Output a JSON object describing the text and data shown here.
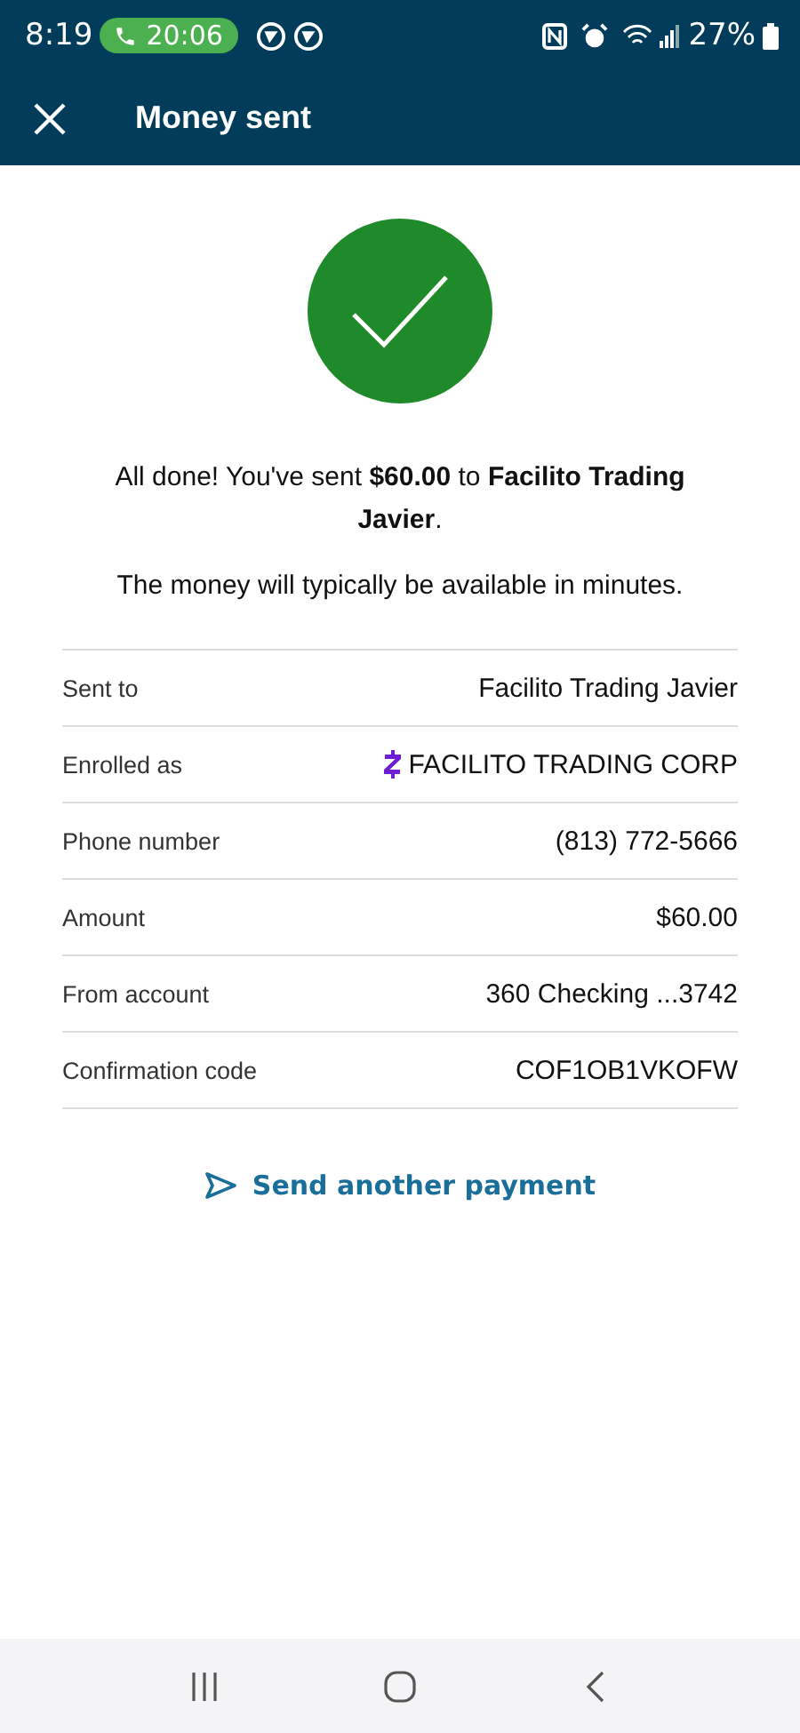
{
  "status_bar": {
    "time": "8:19",
    "call_timer": "20:06",
    "battery": "27%"
  },
  "header": {
    "title": "Money sent"
  },
  "message": "All done! You've sent **$60.00** to **Facilito Trading Javier**.",
  "note": "The money will typically be available in minutes.",
  "details": [
    {
      "label": "Sent to",
      "value": "Facilito Trading Javier",
      "kind": "plain"
    },
    {
      "label": "Enrolled as",
      "value": "FACILITO TRADING CORP",
      "kind": "zelle"
    },
    {
      "label": "Phone number",
      "value": "(813) 772-5666",
      "kind": "plain"
    },
    {
      "label": "Amount",
      "value": "$60.00",
      "kind": "plain"
    },
    {
      "label": "From account",
      "value": "360 Checking ...3742",
      "kind": "plain"
    },
    {
      "label": "Confirmation code",
      "value": "COF1OB1VKOFW",
      "kind": "plain"
    }
  ],
  "action": {
    "label": "Send another payment"
  }
}
